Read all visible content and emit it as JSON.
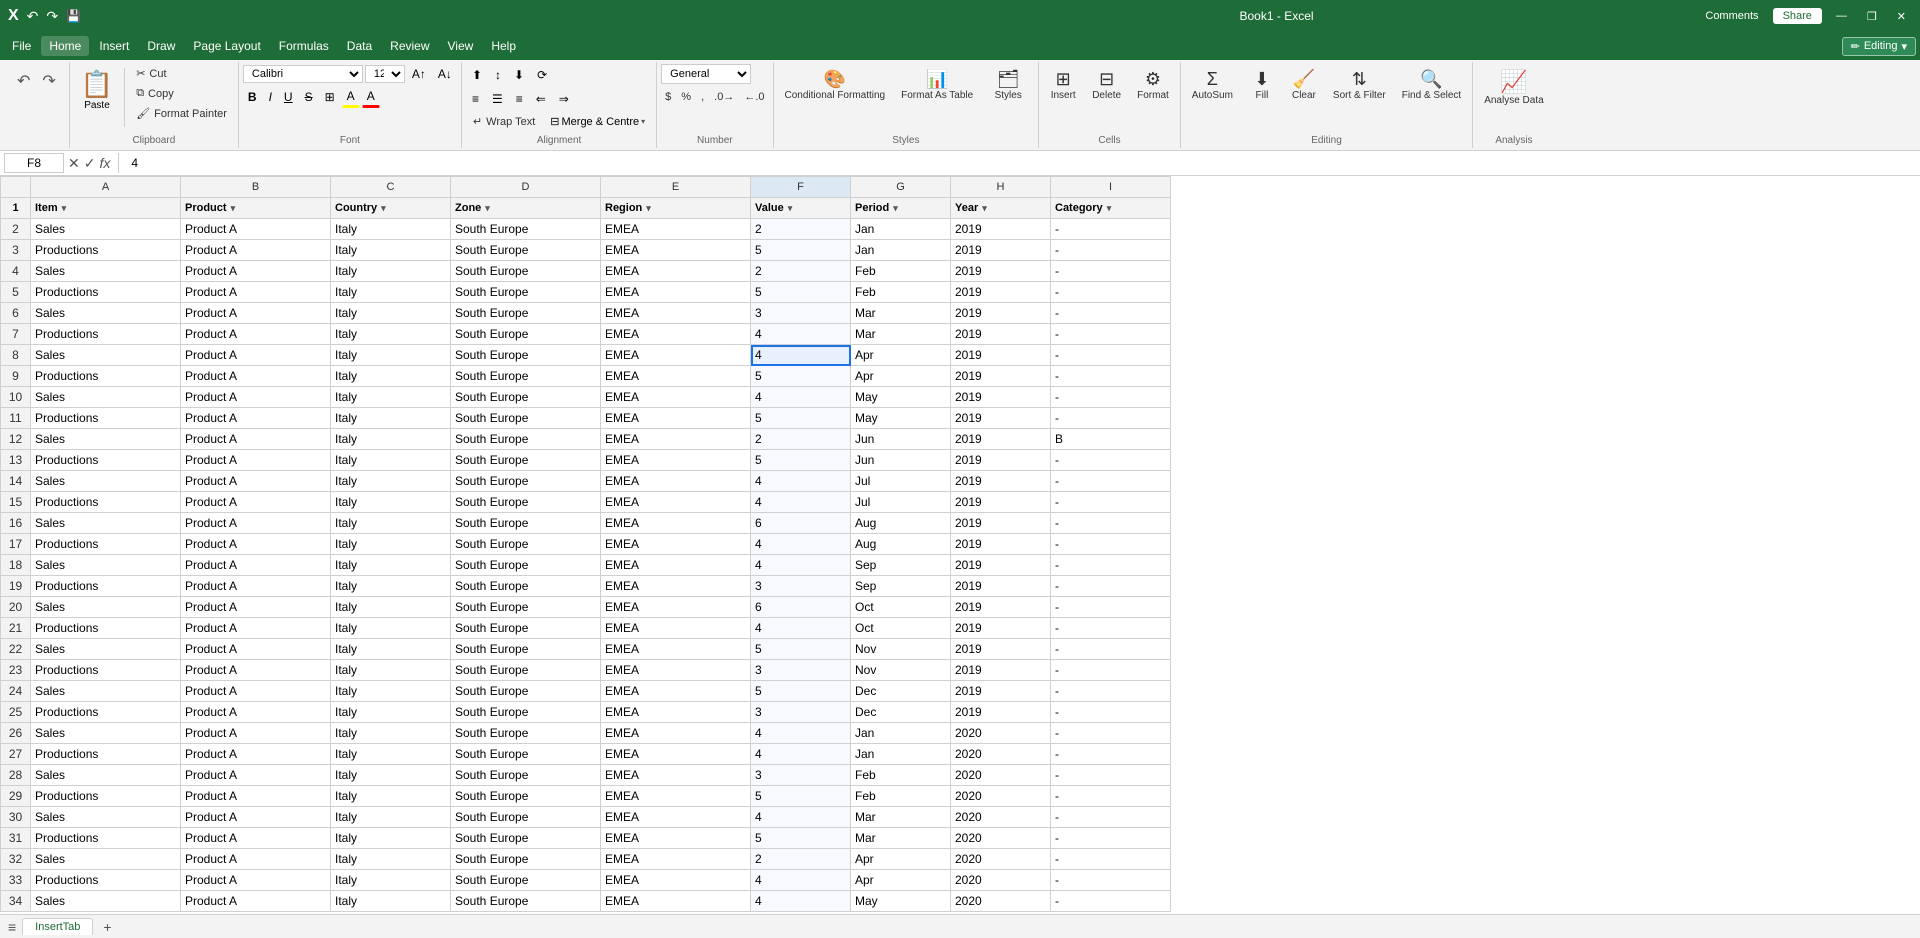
{
  "titleBar": {
    "filename": "Book1 - Excel",
    "comments": "Comments",
    "share": "Share",
    "minimize": "—",
    "restore": "❐",
    "close": "✕"
  },
  "menuBar": {
    "items": [
      "File",
      "Home",
      "Insert",
      "Draw",
      "Page Layout",
      "Formulas",
      "Data",
      "Review",
      "View",
      "Help"
    ],
    "activeItem": "Home",
    "editingMode": "Editing",
    "editingDropdown": "▾"
  },
  "ribbon": {
    "groups": {
      "undo": {
        "title": "Undo",
        "undo": "↶",
        "redo": "↷"
      },
      "clipboard": {
        "title": "Clipboard",
        "paste": "Paste",
        "cut": "Cut",
        "copy": "Copy",
        "formatPainter": "Format Painter"
      },
      "font": {
        "title": "Font",
        "fontName": "Calibri",
        "fontSize": "12",
        "bold": "B",
        "italic": "I",
        "underline": "U",
        "strikethrough": "S",
        "borders": "⊞",
        "fillColor": "A",
        "fontColor": "A"
      },
      "alignment": {
        "title": "Alignment",
        "wrapText": "Wrap Text",
        "mergeCenter": "Merge & Centre",
        "topAlign": "⊤",
        "midAlign": "≡",
        "bottomAlign": "⊥",
        "leftAlign": "≡",
        "centerAlign": "≡",
        "rightAlign": "≡",
        "decreaseIndent": "⇐",
        "increaseIndent": "⇒",
        "orientation": "⟳"
      },
      "number": {
        "title": "Number",
        "format": "General",
        "currency": "$",
        "percent": "%",
        "comma": ",",
        "decIncrease": ".0",
        "decDecrease": ".00"
      },
      "styles": {
        "title": "Styles",
        "conditionalFormatting": "Conditional Formatting",
        "formatAsTable": "Format As Table",
        "styles": "Styles"
      },
      "cells": {
        "title": "Cells",
        "insert": "Insert",
        "delete": "Delete",
        "format": "Format",
        "clear": "Clear"
      },
      "editing": {
        "title": "Editing",
        "autoSum": "AutoSum",
        "fill": "Fill",
        "clear_btn": "Clear",
        "sortFilter": "Sort & Filter",
        "findSelect": "Find & Select"
      },
      "analysis": {
        "title": "Analysis",
        "analyseData": "Analyse Data"
      }
    }
  },
  "formulaBar": {
    "cellRef": "F8",
    "cancelBtn": "✕",
    "confirmBtn": "✓",
    "functionBtn": "fx",
    "formula": "4"
  },
  "columns": {
    "rowHeader": "",
    "headers": [
      "A",
      "B",
      "C",
      "D",
      "E",
      "F",
      "G",
      "H",
      "I"
    ],
    "widths": [
      30,
      150,
      150,
      120,
      150,
      150,
      100,
      100,
      100,
      120
    ]
  },
  "headerRow": {
    "cells": [
      "Item",
      "Product",
      "Country",
      "Zone",
      "Region",
      "Value",
      "Period",
      "Year",
      "Category"
    ],
    "filters": [
      true,
      true,
      true,
      true,
      true,
      true,
      true,
      true,
      true
    ]
  },
  "rows": [
    {
      "row": 2,
      "item": "Sales",
      "product": "Product A",
      "country": "Italy",
      "zone": "South Europe",
      "region": "EMEA",
      "value": "2",
      "period": "Jan",
      "year": "2019",
      "category": "-"
    },
    {
      "row": 3,
      "item": "Productions",
      "product": "Product A",
      "country": "Italy",
      "zone": "South Europe",
      "region": "EMEA",
      "value": "5",
      "period": "Jan",
      "year": "2019",
      "category": "-"
    },
    {
      "row": 4,
      "item": "Sales",
      "product": "Product A",
      "country": "Italy",
      "zone": "South Europe",
      "region": "EMEA",
      "value": "2",
      "period": "Feb",
      "year": "2019",
      "category": "-"
    },
    {
      "row": 5,
      "item": "Productions",
      "product": "Product A",
      "country": "Italy",
      "zone": "South Europe",
      "region": "EMEA",
      "value": "5",
      "period": "Feb",
      "year": "2019",
      "category": "-"
    },
    {
      "row": 6,
      "item": "Sales",
      "product": "Product A",
      "country": "Italy",
      "zone": "South Europe",
      "region": "EMEA",
      "value": "3",
      "period": "Mar",
      "year": "2019",
      "category": "-"
    },
    {
      "row": 7,
      "item": "Productions",
      "product": "Product A",
      "country": "Italy",
      "zone": "South Europe",
      "region": "EMEA",
      "value": "4",
      "period": "Mar",
      "year": "2019",
      "category": "-"
    },
    {
      "row": 8,
      "item": "Sales",
      "product": "Product A",
      "country": "Italy",
      "zone": "South Europe",
      "region": "EMEA",
      "value": "4",
      "period": "Apr",
      "year": "2019",
      "category": "-",
      "selected": true
    },
    {
      "row": 9,
      "item": "Productions",
      "product": "Product A",
      "country": "Italy",
      "zone": "South Europe",
      "region": "EMEA",
      "value": "5",
      "period": "Apr",
      "year": "2019",
      "category": "-"
    },
    {
      "row": 10,
      "item": "Sales",
      "product": "Product A",
      "country": "Italy",
      "zone": "South Europe",
      "region": "EMEA",
      "value": "4",
      "period": "May",
      "year": "2019",
      "category": "-"
    },
    {
      "row": 11,
      "item": "Productions",
      "product": "Product A",
      "country": "Italy",
      "zone": "South Europe",
      "region": "EMEA",
      "value": "5",
      "period": "May",
      "year": "2019",
      "category": "-"
    },
    {
      "row": 12,
      "item": "Sales",
      "product": "Product A",
      "country": "Italy",
      "zone": "South Europe",
      "region": "EMEA",
      "value": "2",
      "period": "Jun",
      "year": "2019",
      "category": "B"
    },
    {
      "row": 13,
      "item": "Productions",
      "product": "Product A",
      "country": "Italy",
      "zone": "South Europe",
      "region": "EMEA",
      "value": "5",
      "period": "Jun",
      "year": "2019",
      "category": "-"
    },
    {
      "row": 14,
      "item": "Sales",
      "product": "Product A",
      "country": "Italy",
      "zone": "South Europe",
      "region": "EMEA",
      "value": "4",
      "period": "Jul",
      "year": "2019",
      "category": "-"
    },
    {
      "row": 15,
      "item": "Productions",
      "product": "Product A",
      "country": "Italy",
      "zone": "South Europe",
      "region": "EMEA",
      "value": "4",
      "period": "Jul",
      "year": "2019",
      "category": "-"
    },
    {
      "row": 16,
      "item": "Sales",
      "product": "Product A",
      "country": "Italy",
      "zone": "South Europe",
      "region": "EMEA",
      "value": "6",
      "period": "Aug",
      "year": "2019",
      "category": "-"
    },
    {
      "row": 17,
      "item": "Productions",
      "product": "Product A",
      "country": "Italy",
      "zone": "South Europe",
      "region": "EMEA",
      "value": "4",
      "period": "Aug",
      "year": "2019",
      "category": "-"
    },
    {
      "row": 18,
      "item": "Sales",
      "product": "Product A",
      "country": "Italy",
      "zone": "South Europe",
      "region": "EMEA",
      "value": "4",
      "period": "Sep",
      "year": "2019",
      "category": "-"
    },
    {
      "row": 19,
      "item": "Productions",
      "product": "Product A",
      "country": "Italy",
      "zone": "South Europe",
      "region": "EMEA",
      "value": "3",
      "period": "Sep",
      "year": "2019",
      "category": "-"
    },
    {
      "row": 20,
      "item": "Sales",
      "product": "Product A",
      "country": "Italy",
      "zone": "South Europe",
      "region": "EMEA",
      "value": "6",
      "period": "Oct",
      "year": "2019",
      "category": "-"
    },
    {
      "row": 21,
      "item": "Productions",
      "product": "Product A",
      "country": "Italy",
      "zone": "South Europe",
      "region": "EMEA",
      "value": "4",
      "period": "Oct",
      "year": "2019",
      "category": "-"
    },
    {
      "row": 22,
      "item": "Sales",
      "product": "Product A",
      "country": "Italy",
      "zone": "South Europe",
      "region": "EMEA",
      "value": "5",
      "period": "Nov",
      "year": "2019",
      "category": "-"
    },
    {
      "row": 23,
      "item": "Productions",
      "product": "Product A",
      "country": "Italy",
      "zone": "South Europe",
      "region": "EMEA",
      "value": "3",
      "period": "Nov",
      "year": "2019",
      "category": "-"
    },
    {
      "row": 24,
      "item": "Sales",
      "product": "Product A",
      "country": "Italy",
      "zone": "South Europe",
      "region": "EMEA",
      "value": "5",
      "period": "Dec",
      "year": "2019",
      "category": "-"
    },
    {
      "row": 25,
      "item": "Productions",
      "product": "Product A",
      "country": "Italy",
      "zone": "South Europe",
      "region": "EMEA",
      "value": "3",
      "period": "Dec",
      "year": "2019",
      "category": "-"
    },
    {
      "row": 26,
      "item": "Sales",
      "product": "Product A",
      "country": "Italy",
      "zone": "South Europe",
      "region": "EMEA",
      "value": "4",
      "period": "Jan",
      "year": "2020",
      "category": "-"
    },
    {
      "row": 27,
      "item": "Productions",
      "product": "Product A",
      "country": "Italy",
      "zone": "South Europe",
      "region": "EMEA",
      "value": "4",
      "period": "Jan",
      "year": "2020",
      "category": "-"
    },
    {
      "row": 28,
      "item": "Sales",
      "product": "Product A",
      "country": "Italy",
      "zone": "South Europe",
      "region": "EMEA",
      "value": "3",
      "period": "Feb",
      "year": "2020",
      "category": "-"
    },
    {
      "row": 29,
      "item": "Productions",
      "product": "Product A",
      "country": "Italy",
      "zone": "South Europe",
      "region": "EMEA",
      "value": "5",
      "period": "Feb",
      "year": "2020",
      "category": "-"
    },
    {
      "row": 30,
      "item": "Sales",
      "product": "Product A",
      "country": "Italy",
      "zone": "South Europe",
      "region": "EMEA",
      "value": "4",
      "period": "Mar",
      "year": "2020",
      "category": "-"
    },
    {
      "row": 31,
      "item": "Productions",
      "product": "Product A",
      "country": "Italy",
      "zone": "South Europe",
      "region": "EMEA",
      "value": "5",
      "period": "Mar",
      "year": "2020",
      "category": "-"
    },
    {
      "row": 32,
      "item": "Sales",
      "product": "Product A",
      "country": "Italy",
      "zone": "South Europe",
      "region": "EMEA",
      "value": "2",
      "period": "Apr",
      "year": "2020",
      "category": "-"
    },
    {
      "row": 33,
      "item": "Productions",
      "product": "Product A",
      "country": "Italy",
      "zone": "South Europe",
      "region": "EMEA",
      "value": "4",
      "period": "Apr",
      "year": "2020",
      "category": "-"
    },
    {
      "row": 34,
      "item": "Sales",
      "product": "Product A",
      "country": "Italy",
      "zone": "South Europe",
      "region": "EMEA",
      "value": "4",
      "period": "May",
      "year": "2020",
      "category": "-"
    }
  ],
  "sheetTabs": {
    "tabs": [
      "InsertTab"
    ],
    "addBtn": "+",
    "menuBtn": "≡"
  },
  "colors": {
    "excelGreen": "#1e6c37",
    "selectedBlue": "#1a73e8",
    "selectedCellBg": "#e8f0fe",
    "headerBg": "#f3f3f3",
    "borderColor": "#d0d0d0",
    "colFHeaderBg": "#dde8f5"
  }
}
